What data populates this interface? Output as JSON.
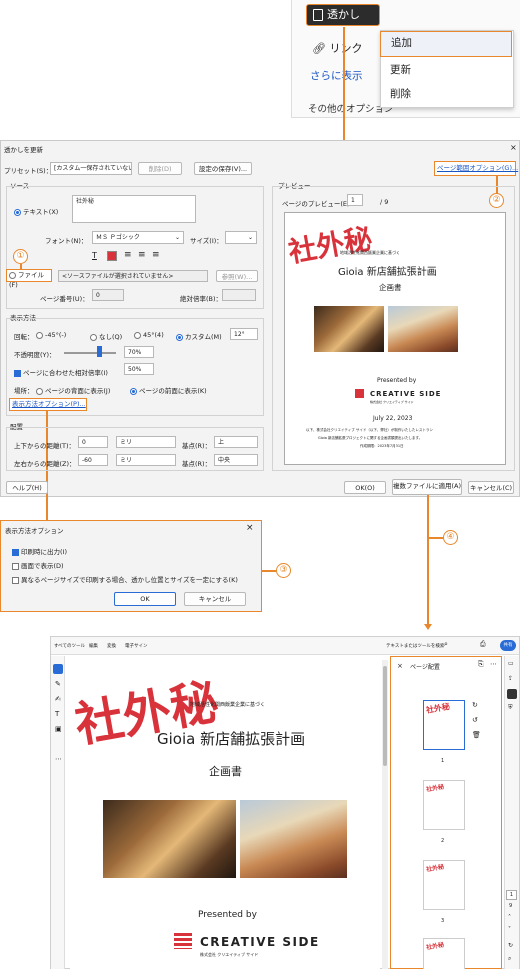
{
  "top_menu": {
    "watermark_button": "透かし",
    "link_item": "リンク",
    "more_item": "さらに表示",
    "other_item": "その他のオプション",
    "submenu": [
      "追加",
      "更新",
      "削除"
    ]
  },
  "callouts": [
    "①",
    "②",
    "③",
    "④"
  ],
  "dialog": {
    "title": "透かしを更新",
    "preset_label": "プリセット(S)：",
    "preset_value": "[カスタム一保存されていない]",
    "delete_btn": "削除(D)",
    "save_settings_btn": "設定の保存(V)...",
    "page_range_link": "ページ範囲オプション(G)...",
    "source_label": "ソース",
    "text_radio": "テキスト(X)",
    "text_value": "社外秘",
    "font_label": "フォント(N)：",
    "font_value": "ＭＳ Ｐゴシック",
    "size_label": "サイズ(I)：",
    "file_radio": "ファイル(F)",
    "file_placeholder": "<ソースファイルが選択されていません>",
    "browse_btn": "参照(W)...",
    "page_number_label": "ページ番号(U)：",
    "page_number_value": "0",
    "absolute_scale_label": "絶対倍率(B)：",
    "appearance_label": "表示方法",
    "rotation_label": "回転：",
    "rotation_options": [
      "-45°(-)",
      "なし(Q)",
      "45°(4)",
      "カスタム(M)"
    ],
    "rotation_custom_value": "12°",
    "opacity_label": "不透明度(Y)：",
    "opacity_value": "70%",
    "relative_scale_label": "ページに合わせた相対倍率(I)",
    "relative_scale_value": "50%",
    "location_label": "場所：",
    "location_behind": "ページの背面に表示(J)",
    "location_front": "ページの前面に表示(K)",
    "appearance_options_link": "表示方法オプション(P)...",
    "position_label": "配置",
    "vdistance_label": "上下からの距離(T)：",
    "vdistance_value": "0",
    "hdistance_label": "左右からの距離(Z)：",
    "hdistance_value": "-60",
    "unit_value": "ミリ",
    "base_label": "基点(R)：",
    "base_v_value": "上",
    "base_h_value": "中央",
    "preview_label": "プレビュー",
    "preview_page_label": "ページのプレビュー(E)",
    "preview_page_value": "1",
    "preview_page_total": "/ 9",
    "help_btn": "ヘルプ(H)",
    "ok_btn": "OK(O)",
    "apply_multiple_btn": "複数ファイルに適用(A)",
    "cancel_btn": "キャンセル(C)"
  },
  "document": {
    "watermark_text": "社外秘",
    "small_caption": "地域活性化関西飯業企業に基づく",
    "title": "Gioia 新店舗拡張計画",
    "subtitle": "企画書",
    "presented_by": "Presented by",
    "company": "CREATIVE SIDE",
    "company_sub": "株式会社 クリエイティブ サイド",
    "date": "July 22, 2023",
    "note1": "以下、株式会社クリエイティブ サイド（以下、弊社）が制作いたしたレストラン",
    "note2": "Gioia 新店舗拡張プロジェクトに関する企画書類提出いたします。",
    "note3": "作成期限：2023年7月31日"
  },
  "options_dialog": {
    "title": "表示方法オプション",
    "print_check": "印刷時に出力(I)",
    "screen_check": "画面で表示(D)",
    "same_check": "異なるページサイズで印刷する場合、透かし位置とサイズを一定にする(K)",
    "ok_btn": "OK",
    "cancel_btn": "キャンセル"
  },
  "acrobat": {
    "menu": [
      "すべてのツール",
      "編集",
      "変換",
      "電子サイン"
    ],
    "search_label": "テキストまたはツールを検索",
    "account_badge": "共有",
    "panel_title": "ページ配置",
    "page_nums": [
      "1",
      "2",
      "3"
    ],
    "page_counter": "1",
    "page_total": "9"
  },
  "colors": {
    "accent_orange": "#e8872b",
    "stamp_red": "#d8323a",
    "link_blue": "#1a55c4"
  }
}
